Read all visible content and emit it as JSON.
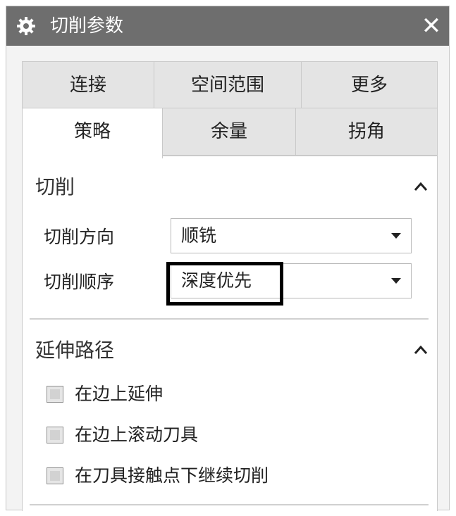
{
  "window": {
    "title": "切削参数",
    "close_symbol": "✕"
  },
  "tabs_back_row": [
    {
      "label": "连接"
    },
    {
      "label": "空间范围"
    },
    {
      "label": "更多"
    }
  ],
  "tabs_front_row": [
    {
      "label": "策略",
      "active": true
    },
    {
      "label": "余量"
    },
    {
      "label": "拐角"
    }
  ],
  "sections": {
    "cutting": {
      "title": "切削",
      "fields": {
        "direction": {
          "label": "切削方向",
          "value": "顺铣"
        },
        "order": {
          "label": "切削顺序",
          "value": "深度优先"
        }
      }
    },
    "extend_path": {
      "title": "延伸路径",
      "options": [
        {
          "label": "在边上延伸",
          "checked": false
        },
        {
          "label": "在边上滚动刀具",
          "checked": false
        },
        {
          "label": "在刀具接触点下继续切削",
          "checked": false
        }
      ]
    }
  },
  "icons": {
    "title": "gear-icon",
    "close": "close-icon",
    "collapse": "chevron-up-icon",
    "dropdown": "caret-down-icon"
  },
  "colors": {
    "titlebar": "#6e6e6e",
    "dialog_bg": "#f3f3f3",
    "tab_inactive": "#e4e4e4",
    "highlight": "#000000"
  }
}
